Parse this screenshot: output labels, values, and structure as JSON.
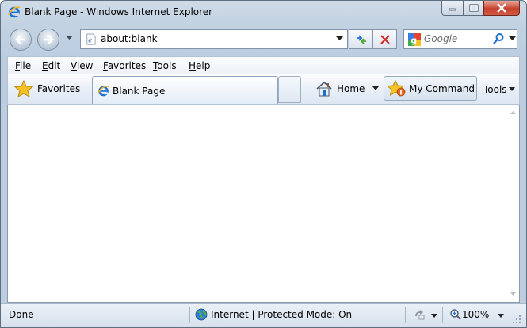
{
  "window": {
    "title": "Blank Page - Windows Internet Explorer",
    "icon": "ie-logo-icon"
  },
  "navigation": {
    "address": "about:blank",
    "search_placeholder": "Google",
    "search_provider": "google-icon"
  },
  "menu": {
    "items": [
      "File",
      "Edit",
      "View",
      "Favorites",
      "Tools",
      "Help"
    ]
  },
  "command_bar": {
    "favorites_label": "Favorites",
    "tab_label": "Blank Page",
    "home_label": "Home",
    "custom_command_label": "My Command",
    "tools_label": "Tools"
  },
  "status_bar": {
    "status": "Done",
    "zone": "Internet | Protected Mode: On",
    "zoom": "100%"
  },
  "colors": {
    "frame": "#c2d2e2",
    "accent_blue": "#1e6fd0",
    "close_red": "#c7412d",
    "stop_red": "#d2302a"
  }
}
